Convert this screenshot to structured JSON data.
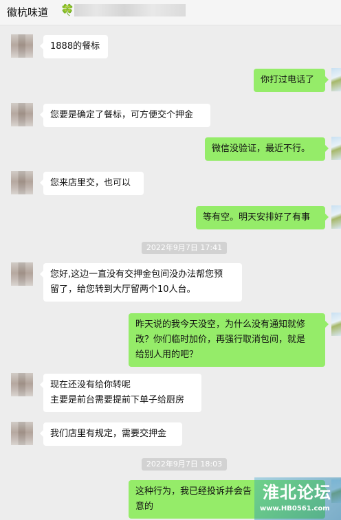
{
  "header": {
    "title": "徽杭味道",
    "clover": "🍀"
  },
  "messages": [
    {
      "side": "left",
      "text": "1888的餐标"
    },
    {
      "side": "right",
      "text": "你打过电话了"
    },
    {
      "side": "left",
      "text": "您要是确定了餐标，可方便交个押金"
    },
    {
      "side": "right",
      "text": "微信没验证，最近不行。"
    },
    {
      "side": "left",
      "text": "您来店里交，也可以"
    },
    {
      "side": "right",
      "text": "等有空。明天安排好了有事"
    },
    {
      "side": "left",
      "lines": [
        "您好,这边一直没有交押金包间没办法帮您预",
        "留了，给您转到大厅留两个10人台。"
      ]
    },
    {
      "side": "right",
      "lines": [
        "昨天说的我今天没空，为什么没有通知就修",
        "改？你们临时加价，再强行取消包间，就是",
        "给别人用的吧？"
      ]
    },
    {
      "side": "left",
      "lines": [
        "现在还没有给你转呢",
        "主要是前台需要提前下单子给厨房"
      ]
    },
    {
      "side": "left",
      "text": "我们店里有规定，需要交押金"
    },
    {
      "side": "right",
      "lines": [
        "这种行为，我已经投诉并会告",
        "意的"
      ]
    }
  ],
  "timestamps": [
    "2022年9月7日 17:41",
    "2022年9月7日 18:03"
  ],
  "watermark": {
    "name": "淮北论坛",
    "url": "www.HB0561.com"
  }
}
